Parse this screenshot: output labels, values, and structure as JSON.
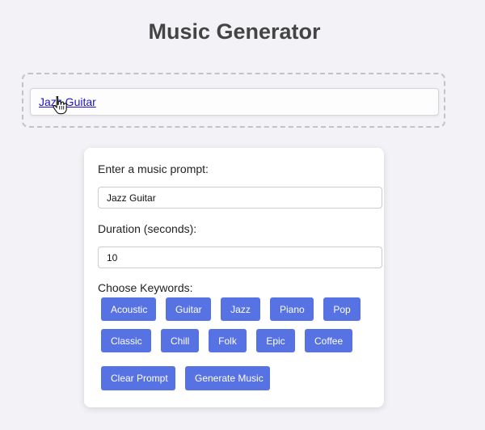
{
  "header": {
    "title": "Music Generator"
  },
  "dropzone": {
    "item_label": "Jazz Guitar"
  },
  "form": {
    "prompt_label": "Enter a music prompt:",
    "prompt_value": "Jazz Guitar",
    "duration_label": "Duration (seconds):",
    "duration_value": "10",
    "keywords_label": "Choose Keywords:"
  },
  "keywords": {
    "row1": [
      "Acoustic",
      "Guitar",
      "Jazz",
      "Piano",
      "Pop"
    ],
    "row2": [
      "Classic",
      "Chill",
      "Folk",
      "Epic",
      "Coffee"
    ]
  },
  "actions": {
    "clear_label": "Clear Prompt",
    "generate_label": "Generate Music"
  },
  "colors": {
    "button_bg": "#5672e3",
    "link": "#1d12c9",
    "page_bg": "#f3f2f7"
  },
  "icons": {
    "cursor": "hand-pointer-icon"
  }
}
